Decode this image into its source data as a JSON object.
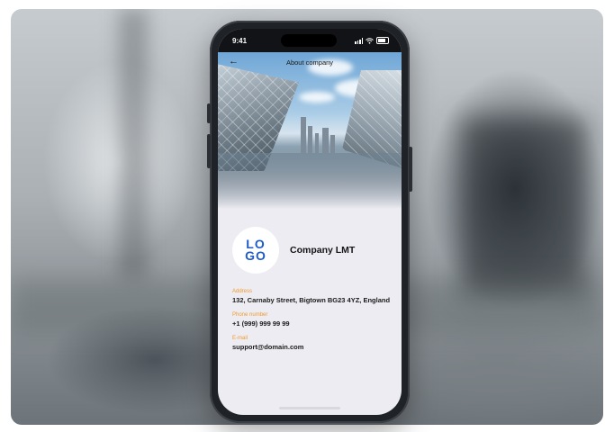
{
  "status_bar": {
    "time": "9:41"
  },
  "header": {
    "title": "About company",
    "back_icon": "arrow-left-icon"
  },
  "company": {
    "logo_top": "LO",
    "logo_bottom": "GO",
    "name": "Company LMT"
  },
  "details": [
    {
      "label": "Address",
      "value": "132, Carnaby Street, Bigtown BG23 4YZ, England"
    },
    {
      "label": "Phone number",
      "value": "+1 (999) 999 99 99"
    },
    {
      "label": "E-mail",
      "value": "support@domain.com"
    }
  ],
  "colors": {
    "accent": "#f39a2a",
    "logo": "#1f5bc9"
  }
}
